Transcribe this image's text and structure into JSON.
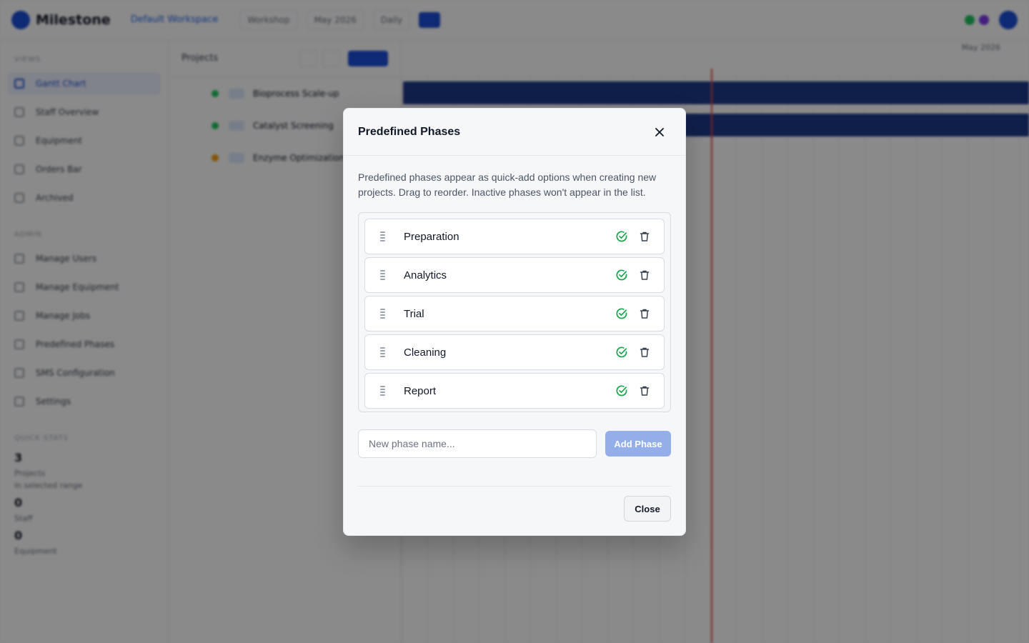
{
  "app": {
    "name": "Milestone",
    "workspace": "Default Workspace",
    "toolbar": {
      "selects": [
        "Workshop",
        "May 2026",
        "Daily"
      ]
    },
    "sidebar": {
      "sections": [
        {
          "title": "Views",
          "items": [
            "Gantt Chart",
            "Staff Overview",
            "Equipment",
            "Orders Bar",
            "Archived"
          ]
        },
        {
          "title": "Admin",
          "items": [
            "Manage Users",
            "Manage Equipment",
            "Manage Jobs",
            "Predefined Phases",
            "SMS Configuration",
            "Settings"
          ]
        }
      ],
      "quick_stats_title": "Quick Stats",
      "stats": [
        {
          "num": "3",
          "label": "Projects",
          "sub": "in selected range"
        },
        {
          "num": "0",
          "label": "Staff",
          "sub": ""
        },
        {
          "num": "0",
          "label": "Equipment",
          "sub": ""
        }
      ]
    },
    "projects": {
      "title": "Projects",
      "rows": [
        "Bioprocess Scale-up",
        "Catalyst Screening",
        "Enzyme Optimization"
      ]
    },
    "gantt_month": "May 2026"
  },
  "modal": {
    "title": "Predefined Phases",
    "description": "Predefined phases appear as quick-add options when creating new projects. Drag to reorder. Inactive phases won't appear in the list.",
    "phases": [
      {
        "name": "Preparation",
        "active": true
      },
      {
        "name": "Analytics",
        "active": true
      },
      {
        "name": "Trial",
        "active": true
      },
      {
        "name": "Cleaning",
        "active": true
      },
      {
        "name": "Report",
        "active": true
      }
    ],
    "new_phase_placeholder": "New phase name...",
    "add_button_label": "Add Phase",
    "close_button_label": "Close"
  },
  "colors": {
    "accent": "#1d4ed8",
    "active_check": "#16a34a",
    "add_button_disabled": "#93aee8",
    "overlay": "rgba(0,0,0,0.46)"
  }
}
